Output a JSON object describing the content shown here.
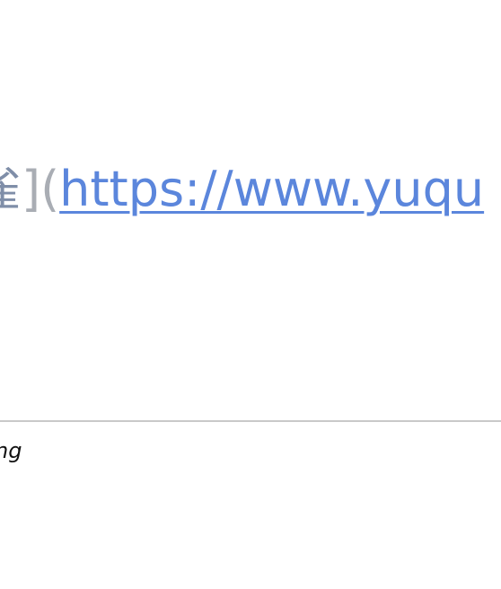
{
  "editor": {
    "link_text_fragment": "雀",
    "bracket_close": "]",
    "paren_open": "(",
    "url_fragment": "https://www.yuqu"
  },
  "footer": {
    "text_fragment": "ng"
  },
  "colors": {
    "link_text": "#7f8ea8",
    "syntax": "#a9adb4",
    "url": "#5b86dc",
    "divider": "#c9c9c9"
  }
}
